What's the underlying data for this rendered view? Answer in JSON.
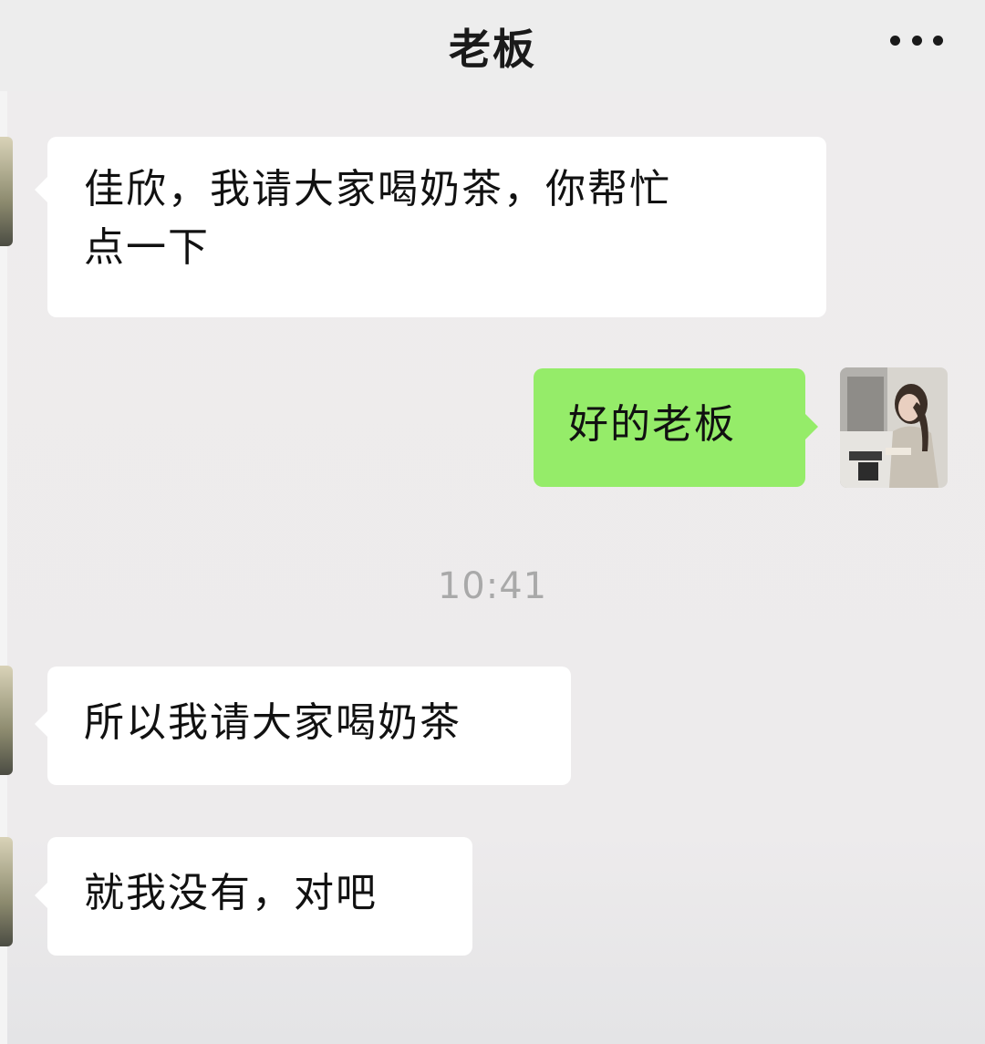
{
  "header": {
    "title": "老板",
    "more_icon": "more-dots-icon"
  },
  "messages": [
    {
      "direction": "in",
      "text_line1": "佳欣，我请大家喝奶茶，你帮忙",
      "text_line2": "点一下"
    },
    {
      "direction": "out",
      "text": "好的老板"
    },
    {
      "direction": "in",
      "text": "所以我请大家喝奶茶"
    },
    {
      "direction": "in",
      "text": "就我没有，对吧"
    }
  ],
  "timestamp": "10:41",
  "colors": {
    "incoming_bubble": "#ffffff",
    "outgoing_bubble": "#95ec69",
    "background": "#ededed"
  }
}
